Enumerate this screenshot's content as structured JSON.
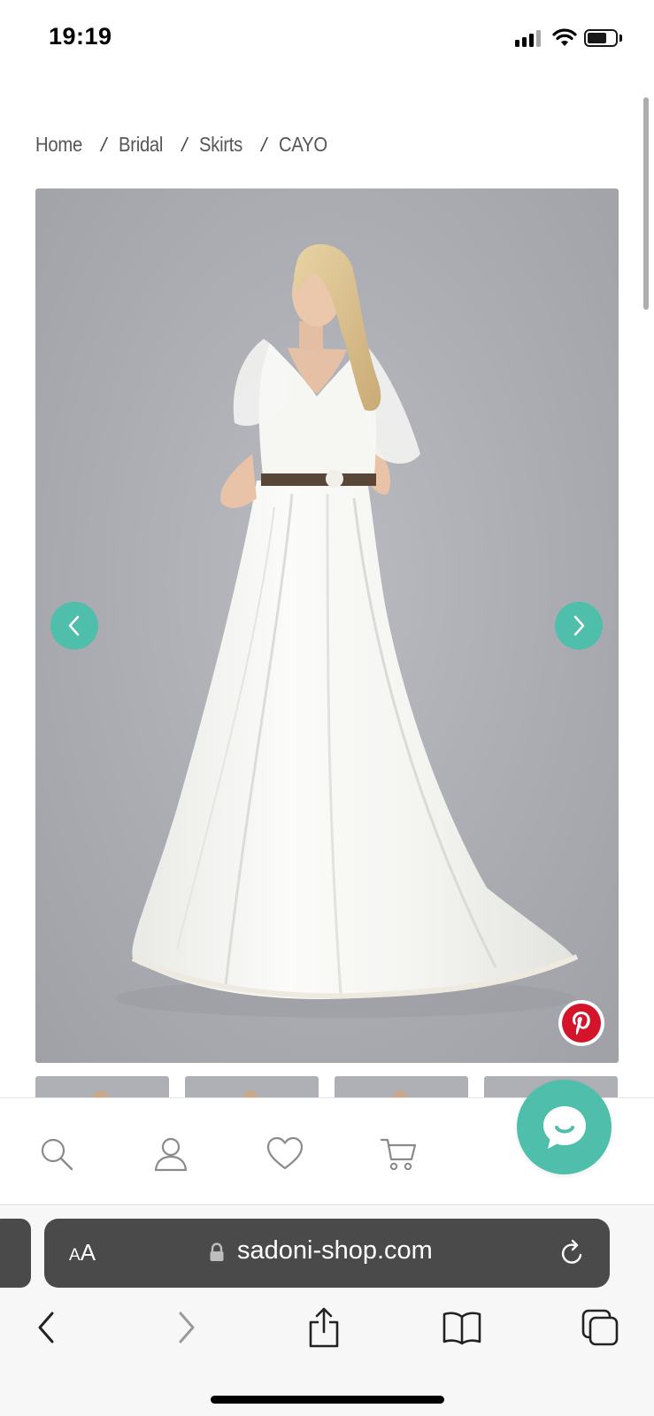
{
  "status_bar": {
    "time": "19:19"
  },
  "breadcrumb": [
    {
      "label": "Home"
    },
    {
      "label": "Bridal"
    },
    {
      "label": "Skirts"
    },
    {
      "label": "CAYO"
    }
  ],
  "breadcrumb_separator": "/",
  "gallery": {
    "thumbnail_count": 4,
    "accent_color": "#4fbeaa",
    "pinterest_color": "#d3142a"
  },
  "bottom_nav": {
    "items": [
      "search-icon",
      "account-icon",
      "wishlist-heart-icon",
      "cart-icon"
    ],
    "chat_button_color": "#4fbeaa"
  },
  "browser": {
    "text_size_label_small": "A",
    "text_size_label_large": "A",
    "url": "sadoni-shop.com"
  }
}
